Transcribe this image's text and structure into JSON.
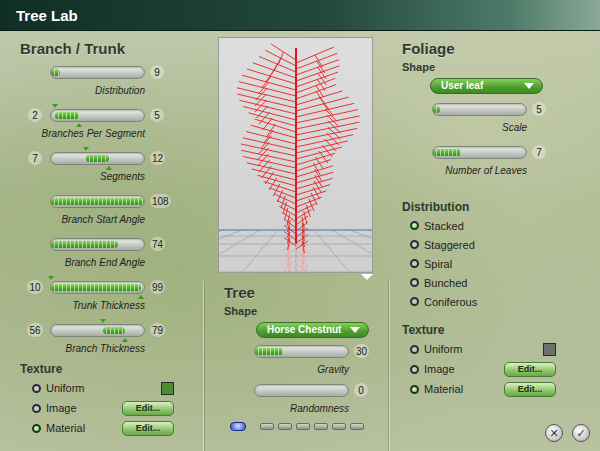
{
  "window": {
    "title": "Tree Lab"
  },
  "branch_trunk": {
    "title": "Branch / Trunk",
    "sliders": [
      {
        "kind": "single",
        "label": "Distribution",
        "value": "9",
        "level": 0.1
      },
      {
        "kind": "range",
        "label": "Branches Per Segment",
        "low": "2",
        "high": "5",
        "start": 0.04,
        "end": 0.3
      },
      {
        "kind": "range",
        "label": "Segments",
        "low": "7",
        "high": "12",
        "start": 0.38,
        "end": 0.62
      },
      {
        "kind": "single",
        "label": "Branch Start Angle",
        "value": "108",
        "level": 1
      },
      {
        "kind": "single",
        "label": "Branch End Angle",
        "value": "74",
        "level": 0.72
      },
      {
        "kind": "range",
        "label": "Trunk Thickness",
        "low": "10",
        "high": "99",
        "start": 0.0,
        "end": 0.97
      },
      {
        "kind": "range",
        "label": "Branch Thickness",
        "low": "56",
        "high": "79",
        "start": 0.56,
        "end": 0.8
      }
    ],
    "texture": {
      "title": "Texture",
      "options": [
        {
          "label": "Uniform",
          "selected": false,
          "kind": "swatch",
          "color": "#4f8a34"
        },
        {
          "label": "Image",
          "selected": false,
          "kind": "edit",
          "button": "Edit..."
        },
        {
          "label": "Material",
          "selected": true,
          "kind": "edit",
          "button": "Edit..."
        }
      ]
    }
  },
  "tree": {
    "title": "Tree",
    "shape": {
      "label": "Shape",
      "value": "Horse Chestnut"
    },
    "sliders": [
      {
        "kind": "single",
        "label": "Gravity",
        "value": "30",
        "level": 0.3
      },
      {
        "kind": "single",
        "label": "Randomness",
        "value": "0",
        "level": 0
      }
    ]
  },
  "pages": [
    {
      "selected": true
    },
    {
      "selected": false
    },
    {
      "selected": false
    },
    {
      "selected": false
    },
    {
      "selected": false
    },
    {
      "selected": false
    },
    {
      "selected": false
    }
  ],
  "foliage": {
    "title": "Foliage",
    "shape": {
      "label": "Shape",
      "value": "User leaf"
    },
    "sliders": [
      {
        "kind": "single",
        "label": "Scale",
        "value": "5",
        "level": 0.07
      },
      {
        "kind": "single",
        "label": "Number of Leaves",
        "value": "7",
        "level": 0.3
      }
    ],
    "distribution": {
      "title": "Distribution",
      "options": [
        {
          "label": "Stacked",
          "selected": true
        },
        {
          "label": "Staggered",
          "selected": false
        },
        {
          "label": "Spiral",
          "selected": false
        },
        {
          "label": "Bunched",
          "selected": false
        },
        {
          "label": "Coniferous",
          "selected": false
        }
      ]
    },
    "texture": {
      "title": "Texture",
      "options": [
        {
          "label": "Uniform",
          "selected": false,
          "kind": "swatch",
          "color": "#6e6e6e"
        },
        {
          "label": "Image",
          "selected": false,
          "kind": "edit",
          "button": "Edit..."
        },
        {
          "label": "Material",
          "selected": true,
          "kind": "edit",
          "button": "Edit..."
        }
      ]
    }
  },
  "buttons": [
    {
      "icon": "✕"
    },
    {
      "icon": "✓"
    }
  ]
}
